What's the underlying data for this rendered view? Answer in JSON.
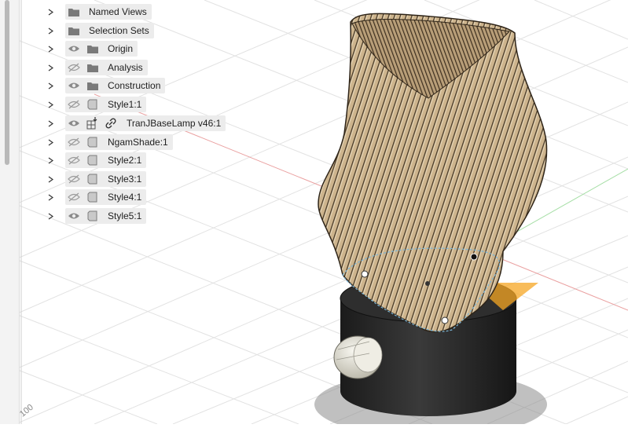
{
  "browser": {
    "items": [
      {
        "label": "Named Views",
        "visible": null,
        "icon": "folder-icon"
      },
      {
        "label": "Selection Sets",
        "visible": null,
        "icon": "folder-icon"
      },
      {
        "label": "Origin",
        "visible": true,
        "icon": "folder-icon"
      },
      {
        "label": "Analysis",
        "visible": false,
        "icon": "folder-icon"
      },
      {
        "label": "Construction",
        "visible": true,
        "icon": "folder-icon"
      },
      {
        "label": "Style1:1",
        "visible": false,
        "icon": "component-icon"
      },
      {
        "label": "TranJBaseLamp v46:1",
        "visible": true,
        "icon": "external-component-icon",
        "linked": true
      },
      {
        "label": "NgamShade:1",
        "visible": false,
        "icon": "component-icon"
      },
      {
        "label": "Style2:1",
        "visible": false,
        "icon": "component-icon"
      },
      {
        "label": "Style3:1",
        "visible": false,
        "icon": "component-icon"
      },
      {
        "label": "Style4:1",
        "visible": false,
        "icon": "component-icon"
      },
      {
        "label": "Style5:1",
        "visible": true,
        "icon": "component-icon"
      }
    ]
  },
  "viewport": {
    "axis_label": "100"
  },
  "colors": {
    "shade": "#c8ad85",
    "rib_dark": "#5a4a35",
    "base": "#2a2a2a",
    "knob": "#e8e6dc",
    "highlight": "#f5a623",
    "grid": "#e4e4e4",
    "red_axis": "#e89a9a",
    "green_axis": "#9ad89a"
  }
}
